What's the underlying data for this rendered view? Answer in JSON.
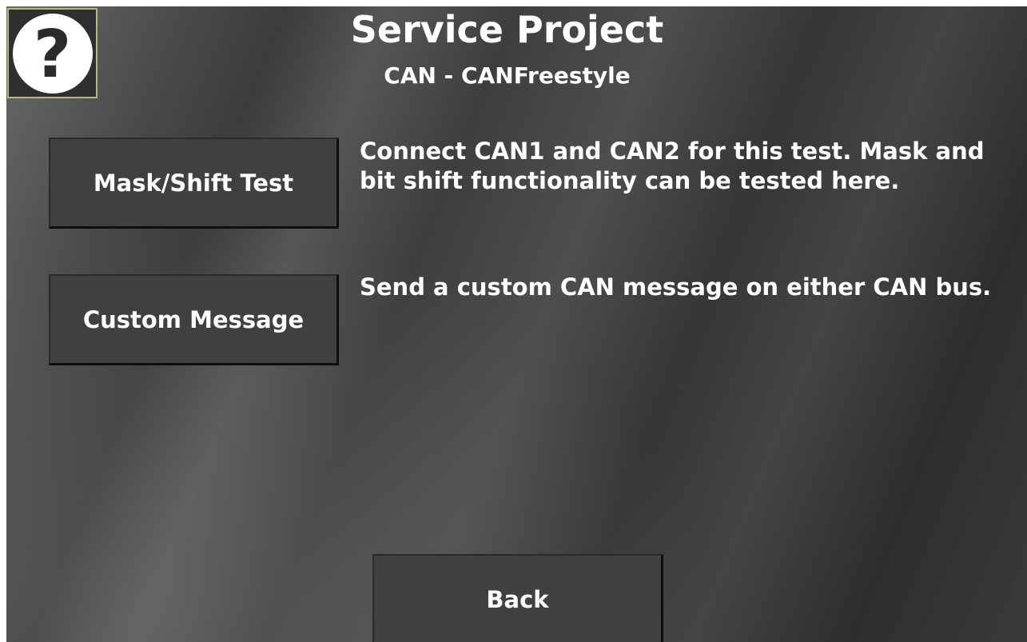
{
  "header": {
    "title": "Service Project",
    "subtitle": "CAN - CANFreestyle"
  },
  "help": {
    "icon": "help-question-icon",
    "glyph": "?"
  },
  "tests": [
    {
      "button_label": "Mask/Shift Test",
      "description": "Connect CAN1 and CAN2 for this test. Mask and bit shift functionality can be tested here."
    },
    {
      "button_label": "Custom Message",
      "description": "Send a custom CAN message on either CAN bus."
    }
  ],
  "footer": {
    "back_label": "Back"
  },
  "colors": {
    "background": "#404040",
    "button_face": "#404040",
    "text": "#ffffff",
    "help_border": "#b8b87a"
  }
}
